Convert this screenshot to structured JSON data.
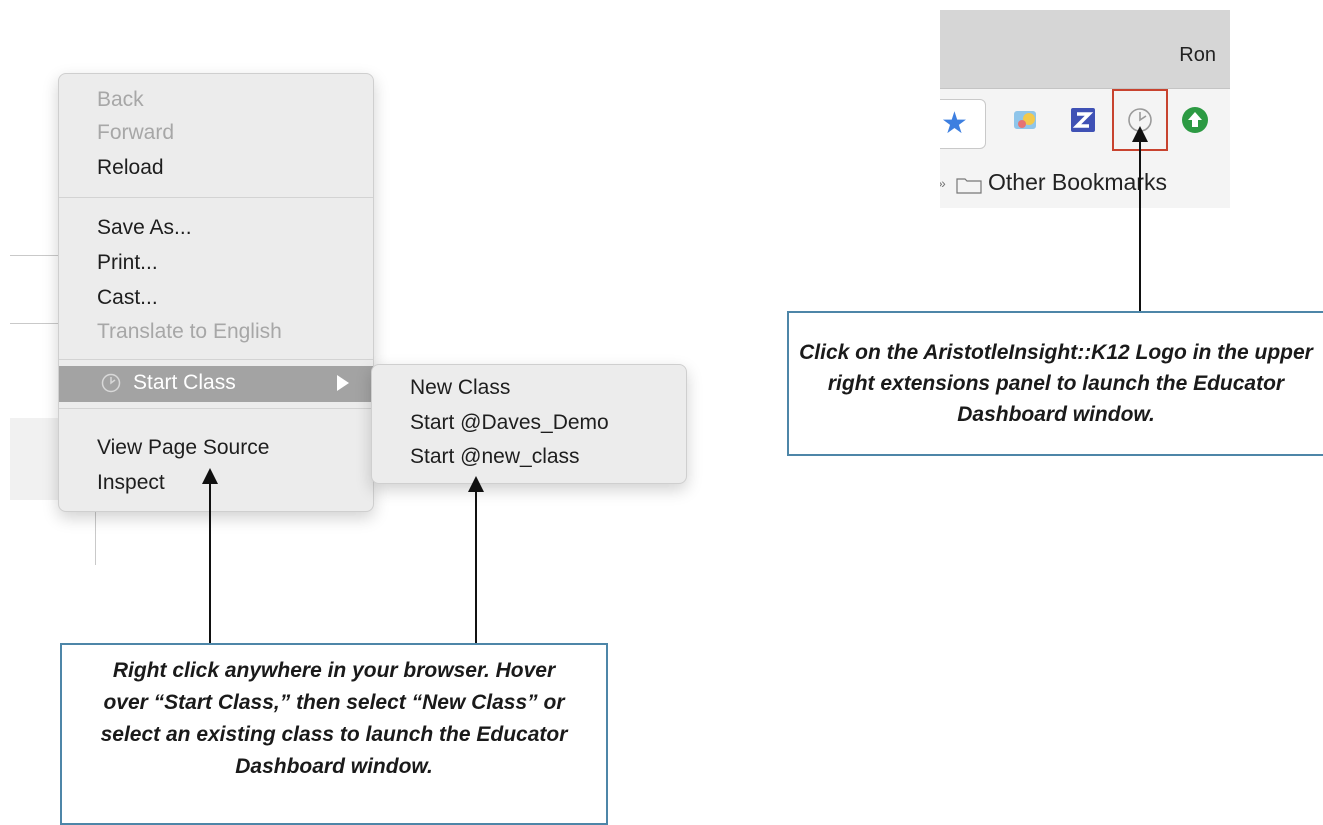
{
  "context_menu": {
    "items": [
      {
        "label": "Back"
      },
      {
        "label": "Forward"
      },
      {
        "label": "Reload"
      },
      {
        "label": "Save As..."
      },
      {
        "label": "Print..."
      },
      {
        "label": "Cast..."
      },
      {
        "label": "Translate to English"
      },
      {
        "label": "Start Class"
      },
      {
        "label": "View Page Source"
      },
      {
        "label": "Inspect"
      }
    ],
    "disabled": [
      "Back",
      "Forward",
      "Translate to English"
    ],
    "highlighted": "Start Class"
  },
  "submenu": {
    "items": [
      {
        "label": "New Class"
      },
      {
        "label": "Start @Daves_Demo"
      },
      {
        "label": "Start @new_class"
      }
    ]
  },
  "browser": {
    "profile_name": "Ron",
    "bookmark_folder": "Other Bookmarks",
    "extensions": [
      "star-icon",
      "image-extension-icon",
      "z-extension-icon",
      "aristotle-clock-icon",
      "green-up-arrow-icon"
    ]
  },
  "callouts": {
    "extension": "Click on the AristotleInsight::K12 Logo in the upper right extensions panel to launch the Educator Dashboard window.",
    "menu": "Right click anywhere in your browser. Hover over “Start Class,” then select “New Class” or select an existing class to launch the Educator Dashboard window."
  },
  "colors": {
    "highlight": "#a3a3a3",
    "callout_border": "#4d86a8",
    "extension_highlight_border": "#c8432f",
    "star_blue": "#3d7fe0",
    "green_extension": "#2c9a43"
  }
}
